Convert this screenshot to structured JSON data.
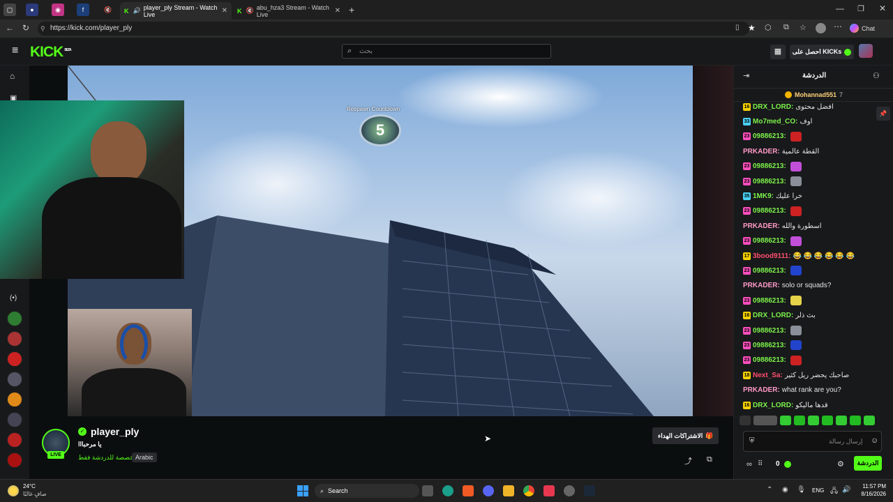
{
  "browser": {
    "tabs": [
      {
        "title": "player_ply Stream - Watch Live"
      },
      {
        "title": "abu_hza3 Stream - Watch Live"
      }
    ],
    "url": "https://kick.com/player_ply",
    "chat_label": "Chat"
  },
  "header": {
    "logo": "KICK",
    "logo_sup": "BETA",
    "search_placeholder": "بحث",
    "get_kicks": "احصل على KICKs"
  },
  "video": {
    "respawn_label": "Respawn Countdown",
    "respawn_number": "5"
  },
  "stream": {
    "channel": "player_ply",
    "title": "يا مرحبااا",
    "category": "مخصصة للدردشة فقط",
    "language": "Arabic",
    "live": "LIVE",
    "subscribe_button": "الاشتراكات الهداء"
  },
  "chat": {
    "title": "الدردشة",
    "pinned_user": "Mohannad551",
    "pinned_count": "7",
    "messages": [
      {
        "badge": "16",
        "badge_color": "#f5d100",
        "user": "DRX_LORD:",
        "user_color": "#7cf24a",
        "text": "افضل محتوى"
      },
      {
        "badge": "33",
        "badge_color": "#4ad1f5",
        "user": "Mo7med_CO:",
        "user_color": "#7cf24a",
        "text": "اوف"
      },
      {
        "badge": "23",
        "badge_color": "#ff4fbf",
        "user": "09886213:",
        "user_color": "#7cf24a",
        "text": ""
      },
      {
        "badge": "",
        "badge_color": "",
        "user": "PRKADER:",
        "user_color": "#ff9ac8",
        "text": "القطة عالمية"
      },
      {
        "badge": "23",
        "badge_color": "#ff4fbf",
        "user": "09886213:",
        "user_color": "#7cf24a",
        "text": ""
      },
      {
        "badge": "23",
        "badge_color": "#ff4fbf",
        "user": "09886213:",
        "user_color": "#7cf24a",
        "text": ""
      },
      {
        "badge": "35",
        "badge_color": "#4ad1f5",
        "user": "1MK9:",
        "user_color": "#7cf24a",
        "text": "خرا عليك"
      },
      {
        "badge": "23",
        "badge_color": "#ff4fbf",
        "user": "09886213:",
        "user_color": "#7cf24a",
        "text": ""
      },
      {
        "badge": "",
        "badge_color": "",
        "user": "PRKADER:",
        "user_color": "#ff9ac8",
        "text": "اسطورة والله"
      },
      {
        "badge": "23",
        "badge_color": "#ff4fbf",
        "user": "09886213:",
        "user_color": "#7cf24a",
        "text": ""
      },
      {
        "badge": "17",
        "badge_color": "#f5d100",
        "user": "3bood9111:",
        "user_color": "#ff4f6e",
        "text": "😂 😂 😂 😂 😂 😂"
      },
      {
        "badge": "23",
        "badge_color": "#ff4fbf",
        "user": "09886213:",
        "user_color": "#7cf24a",
        "text": ""
      },
      {
        "badge": "",
        "badge_color": "",
        "user": "PRKADER:",
        "user_color": "#ff9ac8",
        "text": "solo or squads?"
      },
      {
        "badge": "23",
        "badge_color": "#ff4fbf",
        "user": "09886213:",
        "user_color": "#7cf24a",
        "text": ""
      },
      {
        "badge": "16",
        "badge_color": "#f5d100",
        "user": "DRX_LORD:",
        "user_color": "#7cf24a",
        "text": "بث ذلر"
      },
      {
        "badge": "23",
        "badge_color": "#ff4fbf",
        "user": "09886213:",
        "user_color": "#7cf24a",
        "text": ""
      },
      {
        "badge": "23",
        "badge_color": "#ff4fbf",
        "user": "09886213:",
        "user_color": "#7cf24a",
        "text": ""
      },
      {
        "badge": "23",
        "badge_color": "#ff4fbf",
        "user": "09886213:",
        "user_color": "#7cf24a",
        "text": ""
      },
      {
        "badge": "18",
        "badge_color": "#f5d100",
        "user": "Next_Sa:",
        "user_color": "#ff4f6e",
        "text": "صاحبك يحضر ريل كثير"
      },
      {
        "badge": "",
        "badge_color": "",
        "user": "PRKADER:",
        "user_color": "#ff9ac8",
        "text": "what rank are you?"
      },
      {
        "badge": "16",
        "badge_color": "#f5d100",
        "user": "DRX_LORD:",
        "user_color": "#7cf24a",
        "text": "قدها ماليكو"
      }
    ],
    "input_placeholder": "إرسال رسالة",
    "kicks_count": "0",
    "send_label": "الدردشة"
  },
  "taskbar": {
    "weather_temp": "24°C",
    "weather_desc": "صافٍ غالبًا",
    "search": "Search",
    "lang": "ENG",
    "time": "11:57 PM",
    "date": "8/16/2026"
  },
  "colors": {
    "accent": "#53fc18"
  }
}
